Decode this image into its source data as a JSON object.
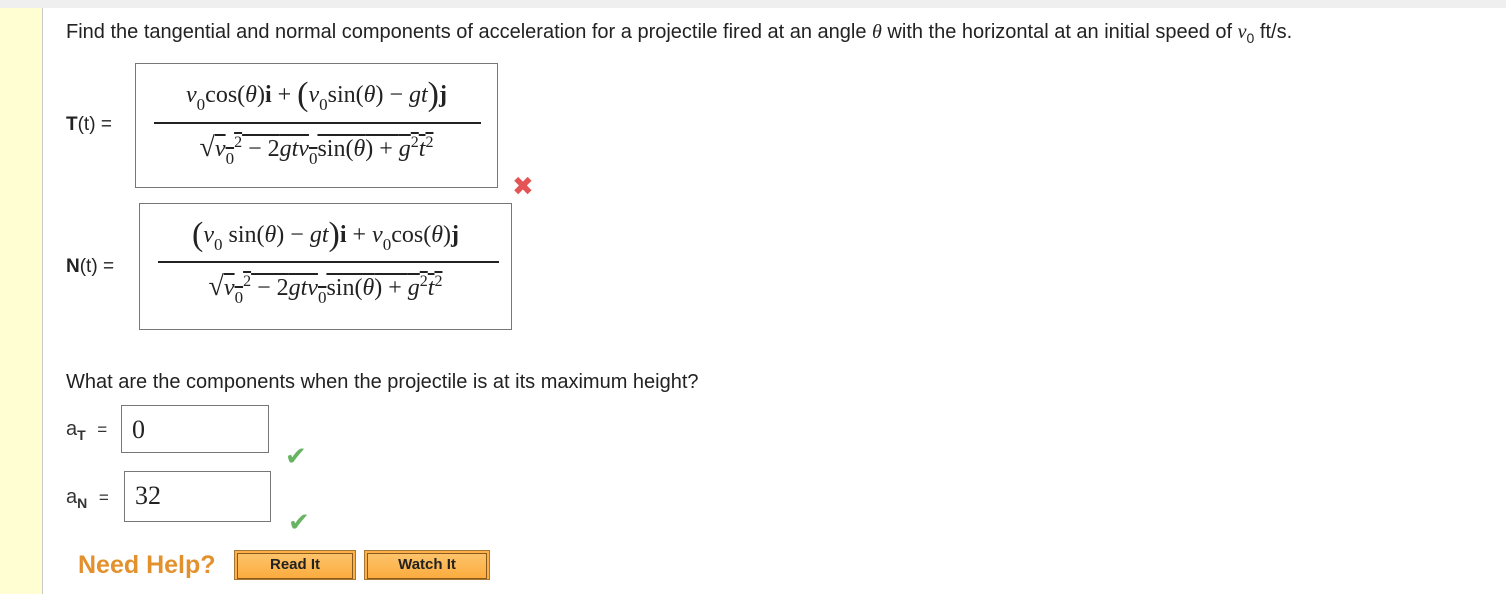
{
  "question": {
    "text_before": "Find the tangential and normal components of acceleration for a projectile fired at an angle ",
    "theta": "θ",
    "text_mid": " with the horizontal at an initial speed of ",
    "v": "v",
    "sub": "0",
    "text_after": " ft/s."
  },
  "T": {
    "label_bold": "T",
    "label_arg": "(t)",
    "eq": " ="
  },
  "N": {
    "label_bold": "N",
    "label_arg": "(t)",
    "eq": " ="
  },
  "T_answer": {
    "numerator": "v₀cos(θ)i + (v₀sin(θ) − gt)j",
    "denominator": "√(v₀² − 2gtv₀sin(θ) + g²t²)",
    "status": "incorrect"
  },
  "N_answer": {
    "numerator": "(v₀ sin(θ) − gt)i + v₀cos(θ)j",
    "denominator": "√(v₀² − 2gtv₀sin(θ) + g²t²)",
    "status": "incorrect"
  },
  "marks": {
    "x": "✖",
    "check": "✔"
  },
  "question2": "What are the components when the projectile is at its maximum height?",
  "aT": {
    "label": "a",
    "sub": "T",
    "eq": "=",
    "value": "0",
    "status": "correct"
  },
  "aN": {
    "label": "a",
    "sub": "N",
    "eq": "=",
    "value": "32",
    "status": "correct"
  },
  "help": {
    "label": "Need Help?",
    "read_it": "Read It",
    "watch_it": "Watch It"
  },
  "colors": {
    "sidebar": "#fffed2",
    "incorrect": "#e45454",
    "correct": "#69b462",
    "help": "#e3912d",
    "button": "#fbb048"
  }
}
